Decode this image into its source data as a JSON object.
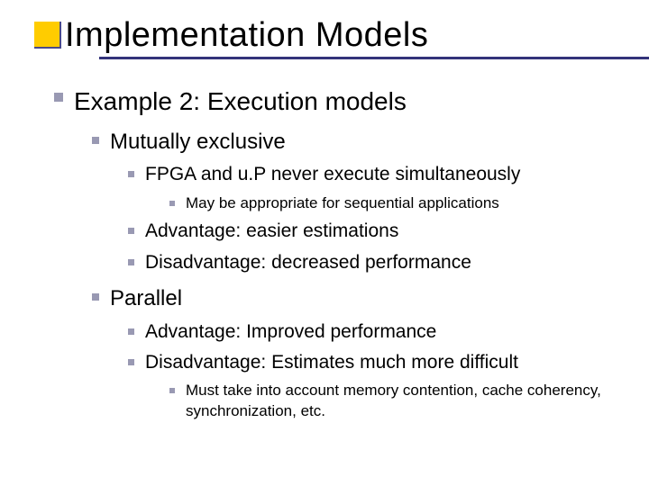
{
  "title": "Implementation Models",
  "l1": "Example 2: Execution models",
  "me": {
    "head": "Mutually exclusive",
    "a": "FPGA and u.P never execute simultaneously",
    "a1": "May be appropriate for sequential applications",
    "b": "Advantage: easier estimations",
    "c": "Disadvantage: decreased performance"
  },
  "par": {
    "head": "Parallel",
    "a": "Advantage: Improved performance",
    "b": "Disadvantage: Estimates much more difficult",
    "b1": "Must take into account memory contention, cache coherency, synchronization, etc."
  }
}
